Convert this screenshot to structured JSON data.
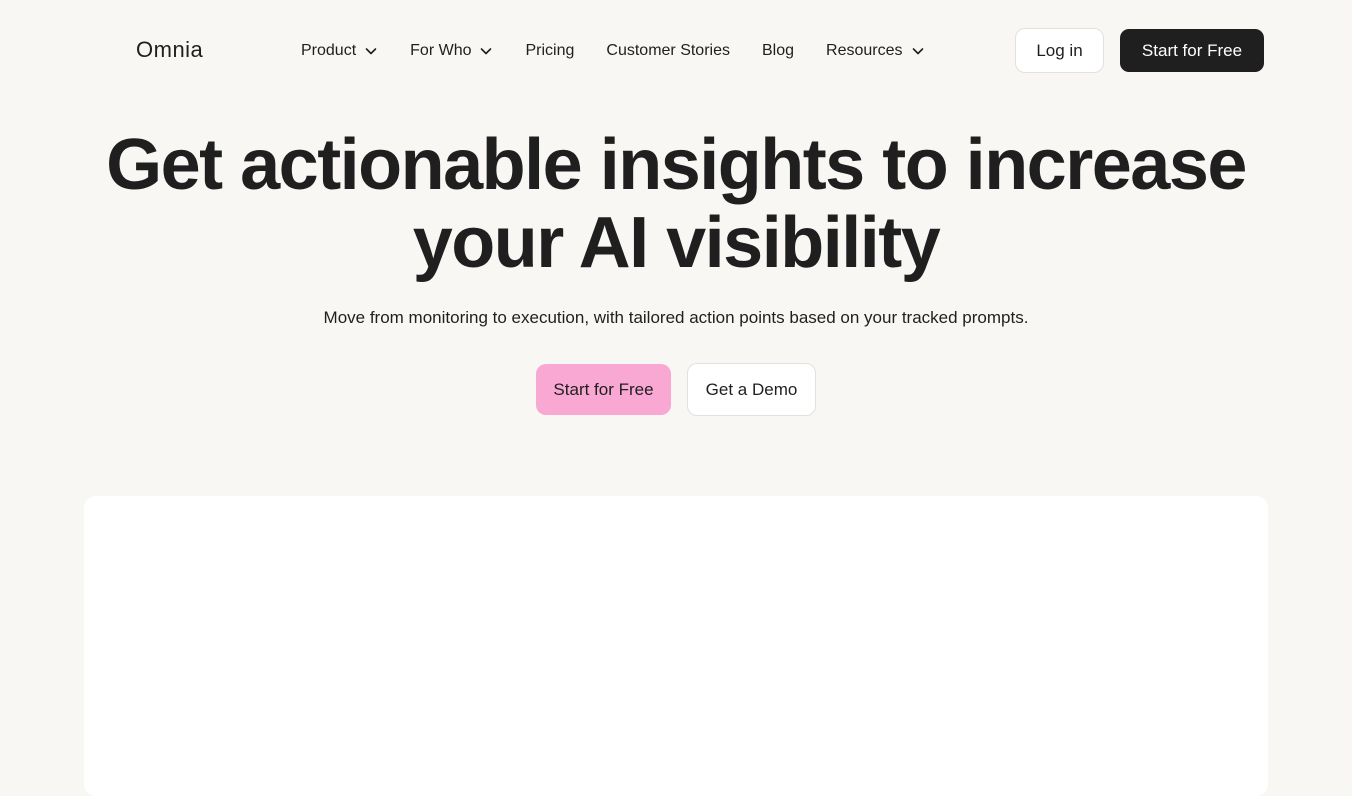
{
  "brand": {
    "name": "Omnia"
  },
  "nav": {
    "items": [
      {
        "label": "Product",
        "has_dropdown": true
      },
      {
        "label": "For Who",
        "has_dropdown": true
      },
      {
        "label": "Pricing",
        "has_dropdown": false
      },
      {
        "label": "Customer Stories",
        "has_dropdown": false
      },
      {
        "label": "Blog",
        "has_dropdown": false
      },
      {
        "label": "Resources",
        "has_dropdown": true
      }
    ],
    "login_label": "Log in",
    "start_label": "Start for Free"
  },
  "hero": {
    "title_line1": "Get actionable insights to increase",
    "title_line2": "your AI visibility",
    "subtitle": "Move from monitoring to execution, with tailored action points based on your tracked prompts.",
    "primary_cta": "Start for Free",
    "secondary_cta": "Get a Demo"
  },
  "colors": {
    "background": "#f9f7f3",
    "primary_dark": "#1f1f1f",
    "accent_pink": "#f9a8d4",
    "card": "#ffffff"
  },
  "icons": {
    "dropdown": "chevron-down-icon"
  }
}
